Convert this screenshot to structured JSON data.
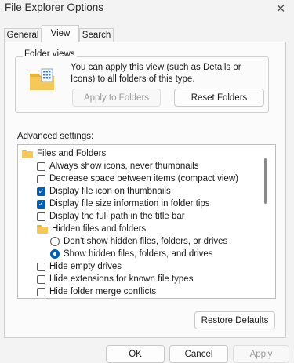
{
  "window": {
    "title": "File Explorer Options"
  },
  "tabs": [
    {
      "label": "General"
    },
    {
      "label": "View"
    },
    {
      "label": "Search"
    }
  ],
  "folder_views": {
    "legend": "Folder views",
    "description": "You can apply this view (such as Details or Icons) to all folders of this type.",
    "apply_button": "Apply to Folders",
    "reset_button": "Reset Folders"
  },
  "advanced": {
    "label": "Advanced settings:",
    "items": [
      {
        "kind": "folder",
        "label": "Files and Folders"
      },
      {
        "kind": "checkbox",
        "label": "Always show icons, never thumbnails",
        "checked": false
      },
      {
        "kind": "checkbox",
        "label": "Decrease space between items (compact view)",
        "checked": false
      },
      {
        "kind": "checkbox",
        "label": "Display file icon on thumbnails",
        "checked": true
      },
      {
        "kind": "checkbox",
        "label": "Display file size information in folder tips",
        "checked": true
      },
      {
        "kind": "checkbox",
        "label": "Display the full path in the title bar",
        "checked": false
      },
      {
        "kind": "folder",
        "label": "Hidden files and folders"
      },
      {
        "kind": "radio",
        "label": "Don't show hidden files, folders, or drives",
        "checked": false
      },
      {
        "kind": "radio",
        "label": "Show hidden files, folders, and drives",
        "checked": true
      },
      {
        "kind": "checkbox",
        "label": "Hide empty drives",
        "checked": false
      },
      {
        "kind": "checkbox",
        "label": "Hide extensions for known file types",
        "checked": false
      },
      {
        "kind": "checkbox",
        "label": "Hide folder merge conflicts",
        "checked": false
      }
    ]
  },
  "buttons": {
    "restore": "Restore Defaults",
    "ok": "OK",
    "cancel": "Cancel",
    "apply": "Apply"
  },
  "colors": {
    "accent": "#005fb8",
    "folder": "#f6c858"
  }
}
